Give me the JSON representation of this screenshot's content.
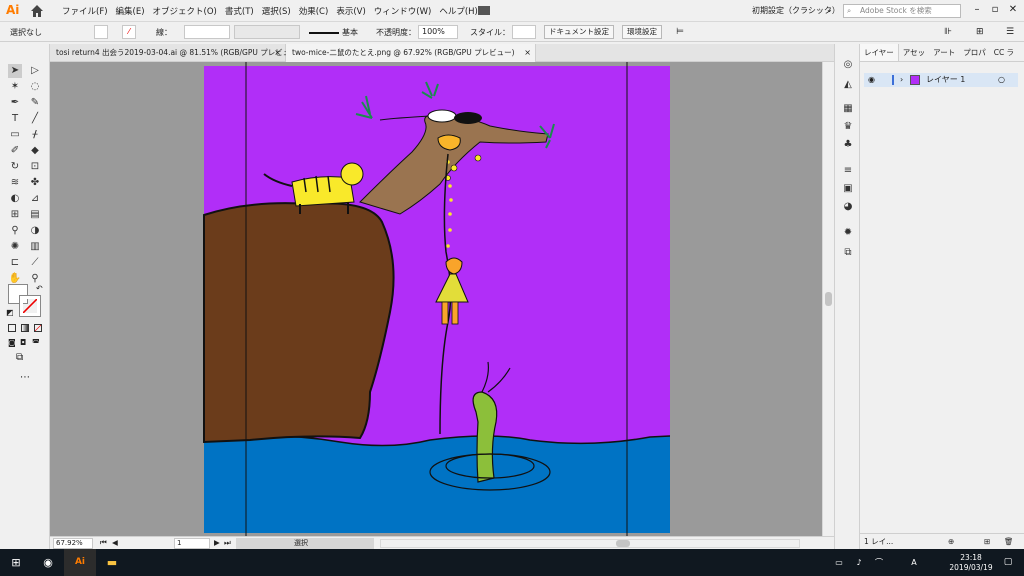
{
  "app": {
    "logo": "Ai",
    "menus": [
      "ファイル(F)",
      "編集(E)",
      "オブジェクト(O)",
      "書式(T)",
      "選択(S)",
      "効果(C)",
      "表示(V)",
      "ウィンドウ(W)",
      "ヘルプ(H)"
    ],
    "workspace": "初期設定（クラシック）",
    "stock_placeholder": "Adobe Stock を検索"
  },
  "control_bar": {
    "selection_label": "選択なし",
    "stroke_label": "線：",
    "brush_label": "基本",
    "opacity_label": "不透明度：",
    "opacity_value": "100%",
    "style_label": "スタイル：",
    "doc_settings_button": "ドキュメント設定",
    "prefs_button": "環境設定"
  },
  "tabs": [
    {
      "label": "tosi return4 出会う2019-03-04.ai @ 81.51% (RGB/GPU プレビュー)",
      "active": false
    },
    {
      "label": "two-mice-二鼠のたとえ.png @ 67.92% (RGB/GPU プレビュー)",
      "active": true
    }
  ],
  "status": {
    "zoom": "67.92%",
    "page": "1",
    "mode": "選択"
  },
  "layers_panel": {
    "tabs": [
      "レイヤー",
      "アセッ",
      "アート",
      "プロパ",
      "CC ラ"
    ],
    "layer_name": "レイヤー 1",
    "footer": "1 レイ..."
  },
  "taskbar": {
    "time": "23:18",
    "date": "2019/03/19",
    "ime": "A"
  },
  "colors": {
    "canvas_bg": "#b12ef8",
    "water": "#0073c4",
    "cliff": "#6b3c1b",
    "tree": "#9a7450",
    "tiger": "#f9e92a",
    "person": "#e2dd39",
    "dragon": "#8cbf3a",
    "accent": "#ff7c00"
  }
}
